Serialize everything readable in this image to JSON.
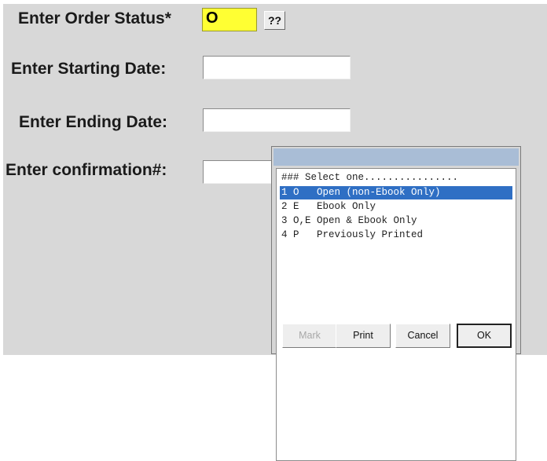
{
  "form": {
    "order_status_label": "Enter Order Status*",
    "order_status_value": "O",
    "help_button": "??",
    "starting_date_label": "Enter Starting Date:",
    "starting_date_value": "",
    "ending_date_label": "Enter Ending Date:",
    "ending_date_value": "",
    "confirmation_label": "Enter confirmation#:",
    "confirmation_value": ""
  },
  "popup": {
    "title": "",
    "header": "### Select one................",
    "options": [
      {
        "text": "1 O   Open (non-Ebook Only)",
        "selected": true
      },
      {
        "text": "2 E   Ebook Only",
        "selected": false
      },
      {
        "text": "3 O,E Open & Ebook Only",
        "selected": false
      },
      {
        "text": "4 P   Previously Printed",
        "selected": false
      }
    ],
    "buttons": {
      "mark": "Mark",
      "print": "Print",
      "cancel": "Cancel",
      "ok": "OK"
    }
  },
  "colors": {
    "status_field": "#ffff33",
    "selection": "#2f6fc4",
    "titlebar": "#a9bdd6"
  }
}
